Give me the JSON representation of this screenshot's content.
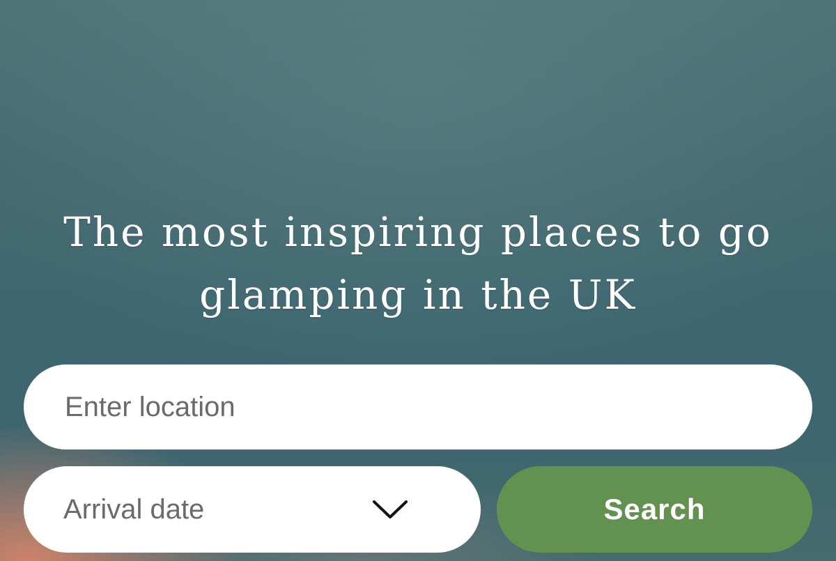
{
  "hero": {
    "headline_line1": "The most inspiring places to go",
    "headline_line2": "glamping in the UK"
  },
  "search_form": {
    "location_placeholder": "Enter location",
    "location_value": "",
    "arrival_date_label": "Arrival date",
    "arrival_date_icon": "chevron-down-icon",
    "search_label": "Search"
  },
  "colors": {
    "accent_button": "#63914f",
    "text_on_hero": "#ffffff",
    "placeholder_text": "#6a6a6a"
  }
}
